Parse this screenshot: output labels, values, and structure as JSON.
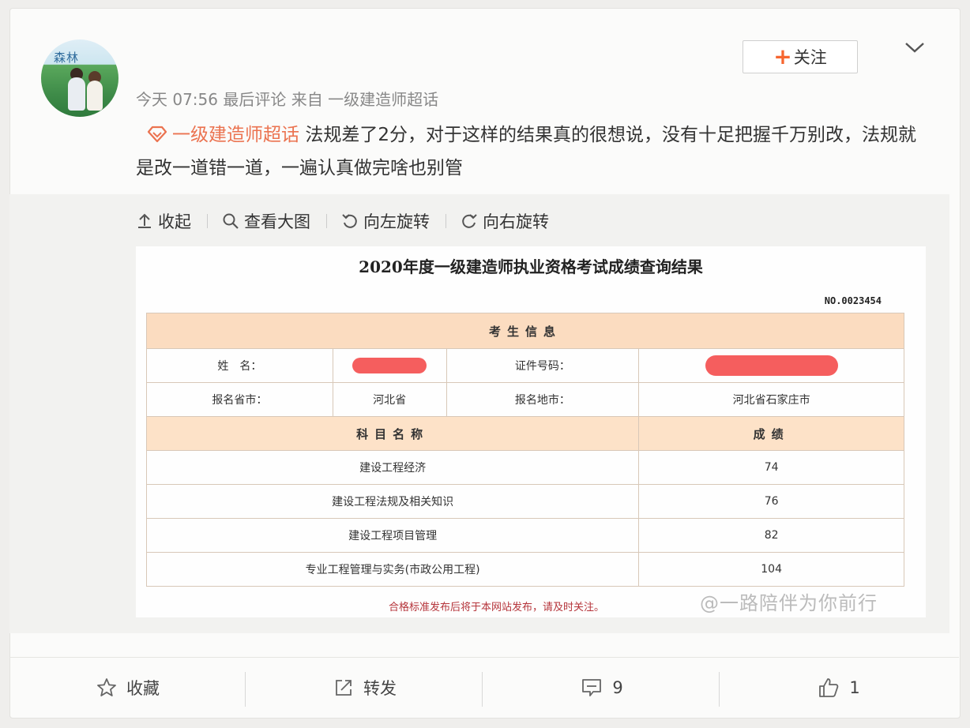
{
  "post": {
    "meta": "今天 07:56 最后评论 来自 一级建造师超话",
    "follow_label": "关注",
    "topic": "一级建造师超话",
    "text": "法规差了2分，对于这样的结果真的很想说，没有十足把握千万别改，法规就是改一道错一道，一遍认真做完啥也别管",
    "avatar_text": "森林"
  },
  "toolbar": {
    "collapse": "收起",
    "view_large": "查看大图",
    "rotate_left": "向左旋转",
    "rotate_right": "向右旋转"
  },
  "result": {
    "title": "2020年度一级建造师执业资格考试成绩查询结果",
    "number": "NO.0023454",
    "section_candidate": "考生信息",
    "name_label": "姓　名：",
    "id_label": "证件号码：",
    "province_label": "报名省市：",
    "province_value": "河北省",
    "site_label": "报名地市：",
    "site_value": "河北省石家庄市",
    "subject_header": "科目名称",
    "score_header": "成绩",
    "subjects": [
      {
        "name": "建设工程经济",
        "score": "74"
      },
      {
        "name": "建设工程法规及相关知识",
        "score": "76"
      },
      {
        "name": "建设工程项目管理",
        "score": "82"
      },
      {
        "name": "专业工程管理与实务(市政公用工程)",
        "score": "104"
      }
    ],
    "footer_note": "合格标准发布后将于本网站发布，请及时关注。",
    "watermark": "@一路陪伴为你前行"
  },
  "actions": {
    "favorite": "收藏",
    "repost": "转发",
    "comment_count": "9",
    "like_count": "1"
  },
  "colors": {
    "topic": "#eb7350",
    "follow_plus": "#f7662f",
    "table_header": "#fbdcc0",
    "redaction": "#f55e5e",
    "footer_note": "#b5343a"
  }
}
